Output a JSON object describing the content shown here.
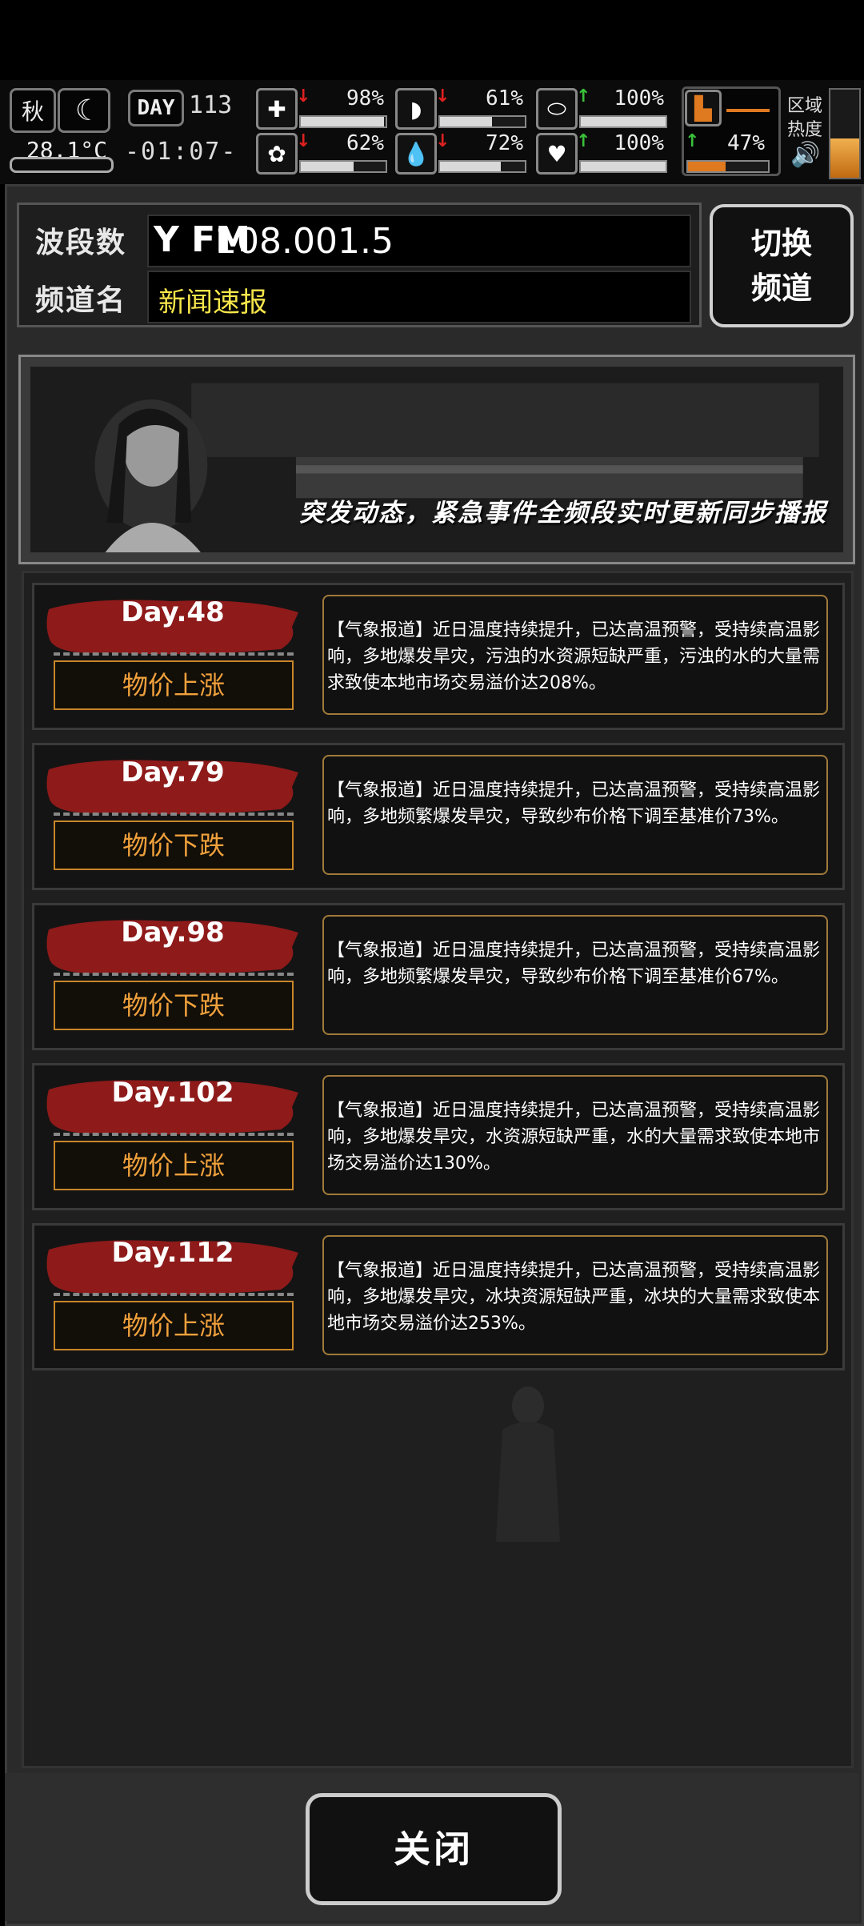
{
  "hud": {
    "season": "秋",
    "temperature": "28.1°C",
    "day_tag": "DAY",
    "day_number": "113",
    "clock": "-01:07-",
    "stats": [
      {
        "icon": "medkit-icon",
        "glyph": "✚",
        "trend": "down",
        "arrow": "↓",
        "percent": "98%",
        "level": 0.98
      },
      {
        "icon": "stomach-icon",
        "glyph": "◗",
        "trend": "down",
        "arrow": "↓",
        "percent": "61%",
        "level": 0.61
      },
      {
        "icon": "lung-icon",
        "glyph": "⬭",
        "trend": "up",
        "arrow": "↑",
        "percent": "100%",
        "level": 1.0
      },
      {
        "icon": "brain-icon",
        "glyph": "✿",
        "trend": "down",
        "arrow": "↓",
        "percent": "62%",
        "level": 0.62
      },
      {
        "icon": "water-drop-icon",
        "glyph": "💧",
        "trend": "down",
        "arrow": "↓",
        "percent": "72%",
        "level": 0.72
      },
      {
        "icon": "heart-icon",
        "glyph": "♥",
        "trend": "up",
        "arrow": "↑",
        "percent": "100%",
        "level": 1.0
      },
      {
        "icon": "boot-icon",
        "glyph": "▙",
        "trend": "up",
        "arrow": "↑",
        "percent": "47%",
        "level": 0.47
      }
    ],
    "region_label": "区域热度",
    "heat_level": 0.45
  },
  "radio": {
    "freq_label": "波段数",
    "freq_icon": "Y FM",
    "frequency": "108.001.5",
    "channel_label": "频道名",
    "channel_name": "新闻速报",
    "switch_button": "切换频道"
  },
  "banner": {
    "caption": "突发动态，紧急事件全频段实时更新同步播报"
  },
  "news": [
    {
      "day": "Day.48",
      "tag": "物价上涨",
      "text": "【气象报道】近日温度持续提升，已达高温预警，受持续高温影响，多地爆发旱灾，污浊的水资源短缺严重，污浊的水的大量需求致使本地市场交易溢价达208%。"
    },
    {
      "day": "Day.79",
      "tag": "物价下跌",
      "text": "【气象报道】近日温度持续提升，已达高温预警，受持续高温影响，多地频繁爆发旱灾，导致纱布价格下调至基准价73%。"
    },
    {
      "day": "Day.98",
      "tag": "物价下跌",
      "text": "【气象报道】近日温度持续提升，已达高温预警，受持续高温影响，多地频繁爆发旱灾，导致纱布价格下调至基准价67%。"
    },
    {
      "day": "Day.102",
      "tag": "物价上涨",
      "text": "【气象报道】近日温度持续提升，已达高温预警，受持续高温影响，多地爆发旱灾，水资源短缺严重，水的大量需求致使本地市场交易溢价达130%。"
    },
    {
      "day": "Day.112",
      "tag": "物价上涨",
      "text": "【气象报道】近日温度持续提升，已达高温预警，受持续高温影响，多地爆发旱灾，冰块资源短缺严重，冰块的大量需求致使本地市场交易溢价达253%。"
    }
  ],
  "footer": {
    "close_button": "关闭"
  },
  "colors": {
    "channel_text": "#f7e64a",
    "tag_text": "#f0a13c",
    "trend_down": "#e02020",
    "trend_up": "#39c23a",
    "brush_red": "#8e1a1a"
  }
}
